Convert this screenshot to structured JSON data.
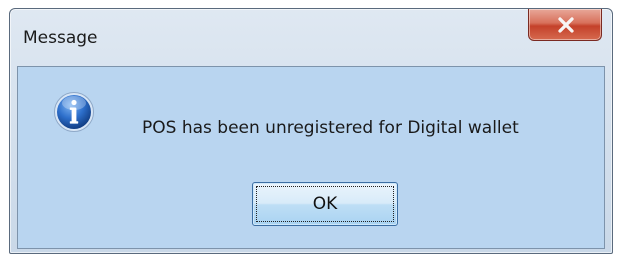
{
  "window": {
    "title": "Message"
  },
  "dialog": {
    "icon": "information-icon",
    "message": "POS has been unregistered for Digital wallet",
    "ok_label": "OK"
  },
  "colors": {
    "client_background": "#b9d5f0",
    "close_button": "#c4412a",
    "info_icon": "#1f5fb8"
  }
}
